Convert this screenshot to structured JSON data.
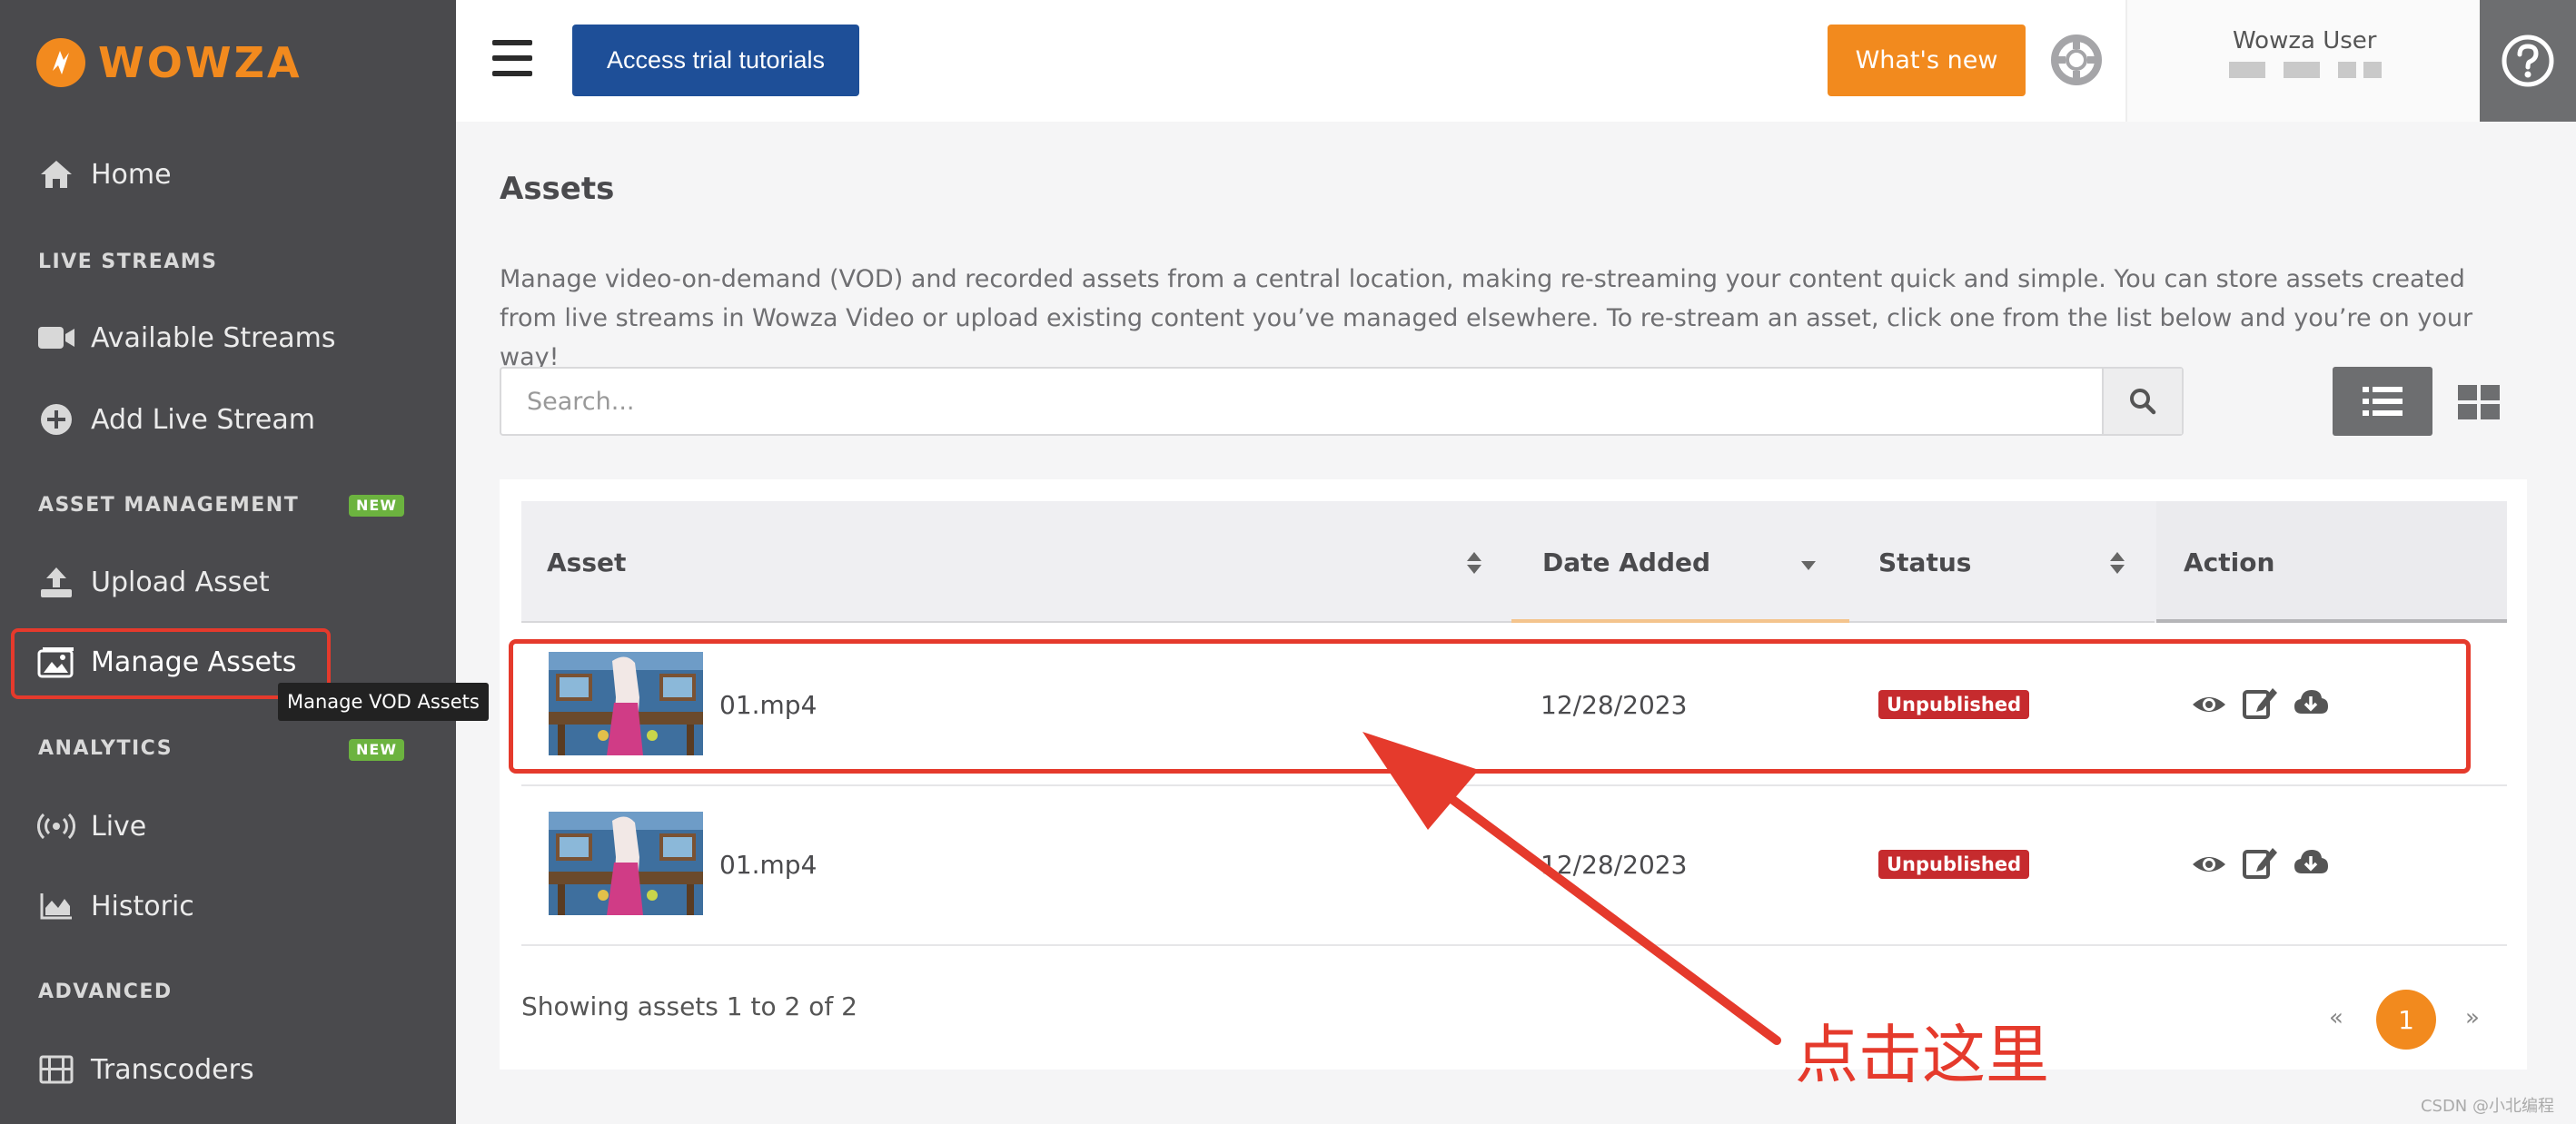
{
  "brand": {
    "name": "WOWZA",
    "color": "#f28a1e"
  },
  "sidebar": {
    "home": "Home",
    "sections": {
      "live_streams": "LIVE STREAMS",
      "asset_management": "ASSET MANAGEMENT",
      "analytics": "ANALYTICS",
      "advanced": "ADVANCED"
    },
    "new_badge": "NEW",
    "items": {
      "available_streams": "Available Streams",
      "add_live_stream": "Add Live Stream",
      "upload_asset": "Upload Asset",
      "manage_assets": "Manage Assets",
      "live": "Live",
      "historic": "Historic",
      "transcoders": "Transcoders"
    },
    "tooltip": "Manage VOD Assets"
  },
  "topbar": {
    "tutorials_label": "Access trial tutorials",
    "whats_new_label": "What's new",
    "user_name": "Wowza User"
  },
  "main": {
    "title": "Assets",
    "description": "Manage video-on-demand (VOD) and recorded assets from a central location, making re-streaming your content quick and simple. You can store assets created from live streams in Wowza Video or upload existing content you’ve managed elsewhere. To re-stream an asset, click one from the list below and you’re on your way!",
    "search_placeholder": "Search..."
  },
  "table": {
    "headers": {
      "asset": "Asset",
      "date_added": "Date Added",
      "status": "Status",
      "action": "Action"
    },
    "rows": [
      {
        "name": "01.mp4",
        "date": "12/28/2023",
        "status": "Unpublished"
      },
      {
        "name": "01.mp4",
        "date": "12/28/2023",
        "status": "Unpublished"
      }
    ],
    "footer": "Showing assets 1 to 2 of 2",
    "pagination": {
      "prev": "«",
      "page": "1",
      "next": "»"
    }
  },
  "annotation": {
    "text": "点击这里"
  },
  "watermark": "CSDN @小北编程",
  "colors": {
    "sidebar": "#4a4a4d",
    "accent": "#f28a1e",
    "primary": "#1e4f98",
    "danger": "#c62b2e",
    "annotation": "#e53a2c"
  }
}
